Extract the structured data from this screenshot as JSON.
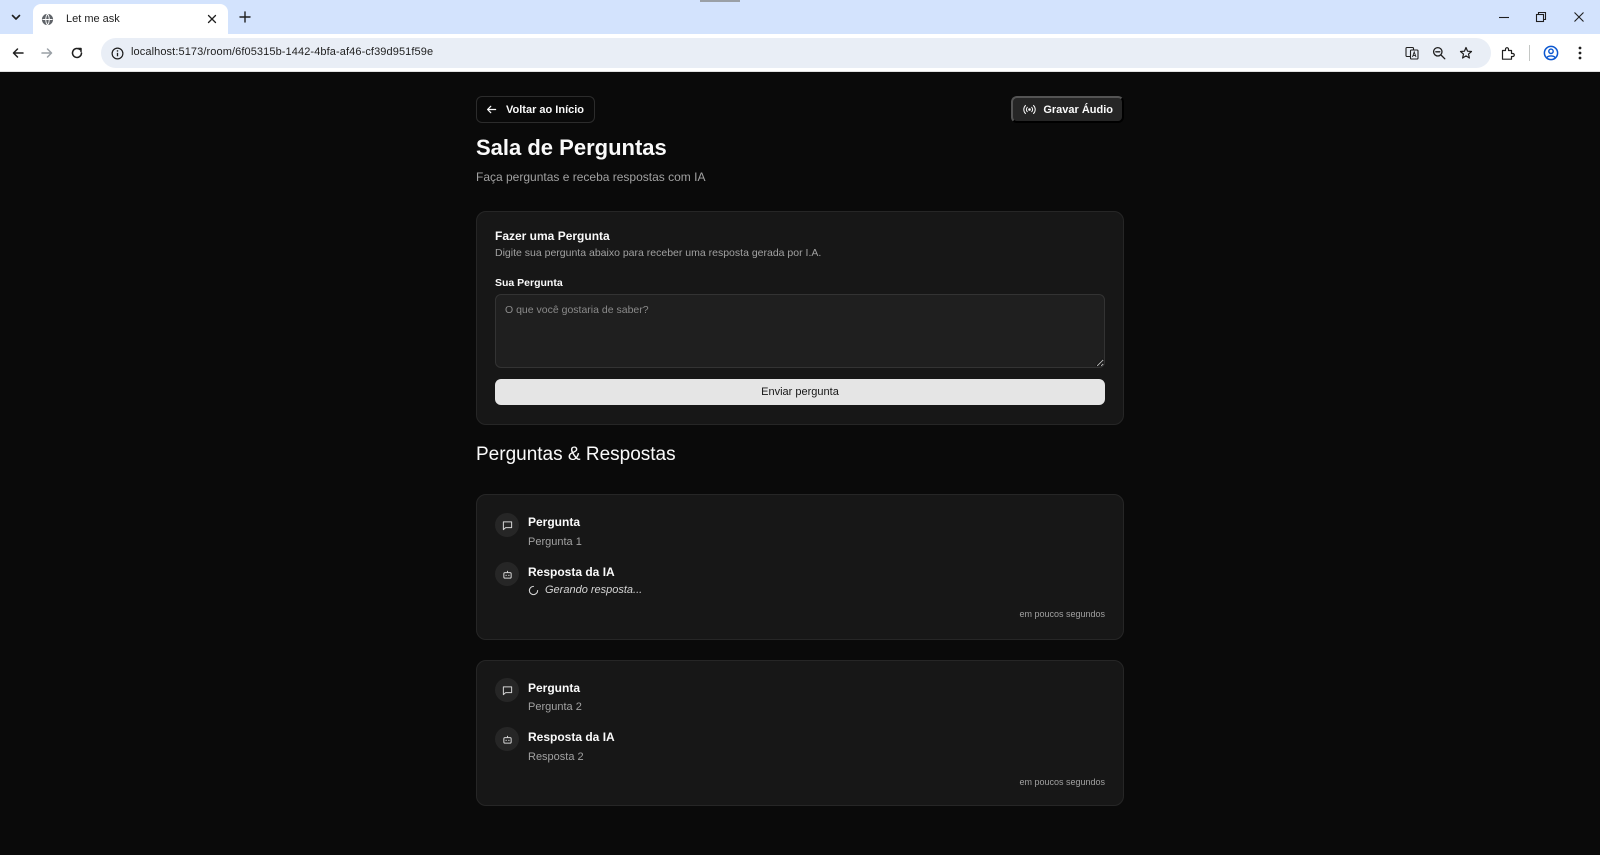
{
  "browser": {
    "tab_title": "Let me ask",
    "url": "localhost:5173/room/6f05315b-1442-4bfa-af46-cf39d951f59e",
    "icons": [
      "tab-search-icon",
      "globe-icon",
      "close-icon",
      "plus-icon",
      "minimize-icon",
      "restore-icon",
      "back-icon",
      "forward-icon",
      "reload-icon",
      "info-icon",
      "translate-icon",
      "zoom-icon",
      "star-icon",
      "extensions-icon",
      "profile-icon",
      "menu-icon"
    ]
  },
  "header": {
    "back_label": "Voltar ao Início",
    "record_label": "Gravar Áudio",
    "title": "Sala de Perguntas",
    "subtitle": "Faça perguntas e receba respostas com IA"
  },
  "ask_form": {
    "title": "Fazer uma Pergunta",
    "description": "Digite sua pergunta abaixo para receber uma resposta gerada por I.A.",
    "field_label": "Sua Pergunta",
    "placeholder": "O que você gostaria de saber?",
    "value": "",
    "submit_label": "Enviar pergunta"
  },
  "qa_section": {
    "title": "Perguntas & Respostas",
    "items": [
      {
        "question_heading": "Pergunta",
        "question_text": "Pergunta 1",
        "answer_heading": "Resposta da IA",
        "answer_text": "Gerando resposta...",
        "answer_loading": true,
        "timestamp": "em poucos segundos"
      },
      {
        "question_heading": "Pergunta",
        "question_text": "Pergunta 2",
        "answer_heading": "Resposta da IA",
        "answer_text": "Resposta 2",
        "answer_loading": false,
        "timestamp": "em poucos segundos"
      }
    ]
  },
  "colors": {
    "background": "#0a0a0a",
    "card": "#171717",
    "border": "#262626",
    "muted_text": "#a1a1a1",
    "primary_button": "#e5e5e5",
    "browser_tabbar": "#d3e3fd"
  }
}
